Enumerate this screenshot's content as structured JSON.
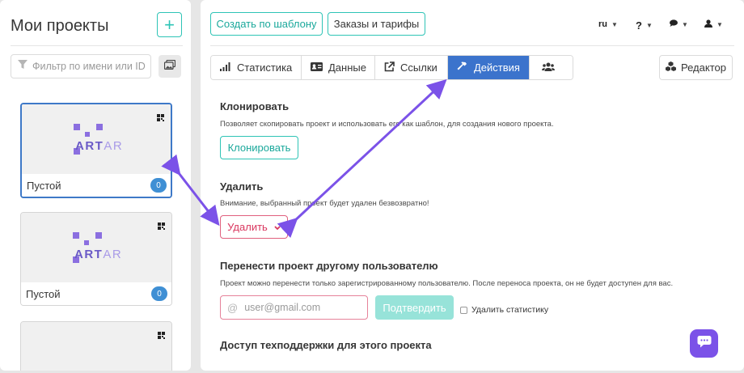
{
  "sidebar": {
    "title": "Мои проекты",
    "add_label": "+",
    "filter_placeholder": "Фильтр по имени или ID",
    "projects": [
      {
        "name": "Пустой",
        "count": "0",
        "logo_text": "ARTAR"
      },
      {
        "name": "Пустой",
        "count": "0",
        "logo_text": "ARTAR"
      }
    ]
  },
  "header": {
    "template_button": "Создать по шаблону",
    "orders_button": "Заказы и тарифы",
    "lang": "ru",
    "help": "?"
  },
  "tabs": [
    {
      "label": "Статистика",
      "icon": "bar-chart-icon"
    },
    {
      "label": "Данные",
      "icon": "id-card-icon"
    },
    {
      "label": "Ссылки",
      "icon": "external-link-icon"
    },
    {
      "label": "Действия",
      "icon": "hammer-icon",
      "active": true
    },
    {
      "label": "",
      "icon": "users-icon"
    }
  ],
  "editor_button": "Редактор",
  "sections": {
    "clone": {
      "title": "Клонировать",
      "desc": "Позволяет скопировать проект и использовать его как шаблон, для создания нового проекта.",
      "button": "Клонировать"
    },
    "delete": {
      "title": "Удалить",
      "desc": "Внимание, выбранный проект будет удален безвозвратно!",
      "button": "Удалить"
    },
    "transfer": {
      "title": "Перенести проект другому пользователю",
      "desc": "Проект можно перенести только зарегистрированному пользователю. После переноса проекта, он не будет доступен для вас.",
      "email_placeholder": "user@gmail.com",
      "confirm_button": "Подтвердить",
      "delete_stats_label": "Удалить статистику"
    },
    "support": {
      "title": "Доступ техподдержки для этого проекта"
    }
  },
  "colors": {
    "accent_teal": "#2ec4b6",
    "active_blue": "#3b73cc",
    "danger": "#d9365e",
    "arrow_purple": "#7b52e8"
  }
}
